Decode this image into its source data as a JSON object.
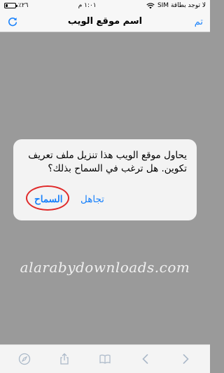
{
  "status_bar": {
    "carrier": "لا توجد بطاقة SIM",
    "time": "١:٠١ م",
    "battery_percent": "٪٢٦",
    "battery_level": 0.26
  },
  "nav": {
    "title": "اسم موقع الويب",
    "done_label": "تم"
  },
  "alert": {
    "message": "يحاول موقع الويب هذا تنزيل ملف تعريف تكوين. هل ترغب في السماح بذلك؟",
    "allow_label": "السماح",
    "ignore_label": "تجاهل"
  },
  "watermark": "alarabydownloads.com",
  "toolbar": {
    "icons": [
      "compass-icon",
      "share-icon",
      "bookmark-icon",
      "back-icon",
      "forward-icon"
    ]
  },
  "colors": {
    "accent": "#1a82fb",
    "highlight_circle": "#e02a2a",
    "dim_background": "#9a9a9a"
  }
}
